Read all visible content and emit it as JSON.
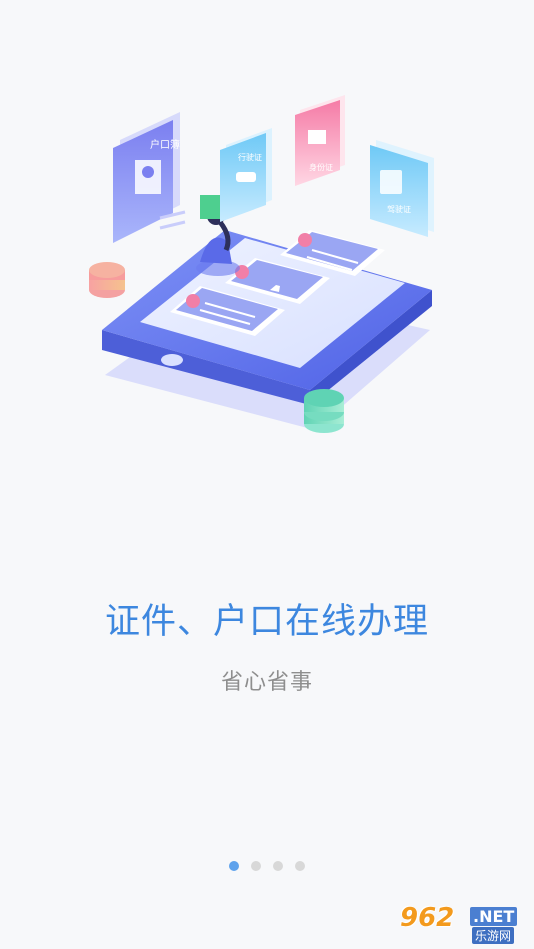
{
  "illustration": {
    "doc_huji": "户口簿",
    "doc_xingche": "行驶证",
    "doc_shenfen": "身份证",
    "doc_jiashi": "驾驶证"
  },
  "content": {
    "headline": "证件、户口在线办理",
    "subline": "省心省事"
  },
  "pager": {
    "total": 4,
    "active_index": 0
  },
  "watermark": {
    "number": "962",
    "suffix": ".NET",
    "cn": "乐游网"
  },
  "colors": {
    "headline": "#3d87df",
    "subline": "#8e8e8e",
    "dot_active": "#5ea2ec",
    "dot_inactive": "#d8d8d8"
  }
}
